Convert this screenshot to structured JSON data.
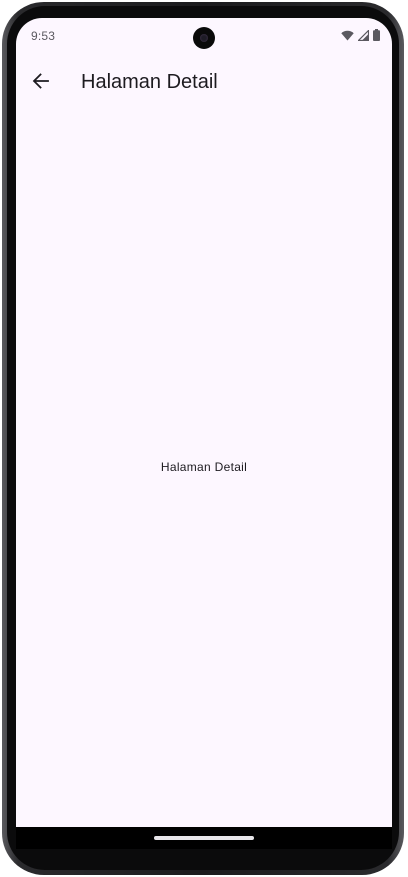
{
  "status_bar": {
    "time": "9:53"
  },
  "app_bar": {
    "title": "Halaman Detail",
    "back_icon": "arrow-back-icon"
  },
  "body": {
    "text": "Halaman Detail"
  },
  "colors": {
    "background": "#fdf7ff",
    "text": "#1d1b20",
    "status_text": "#5b5960"
  }
}
